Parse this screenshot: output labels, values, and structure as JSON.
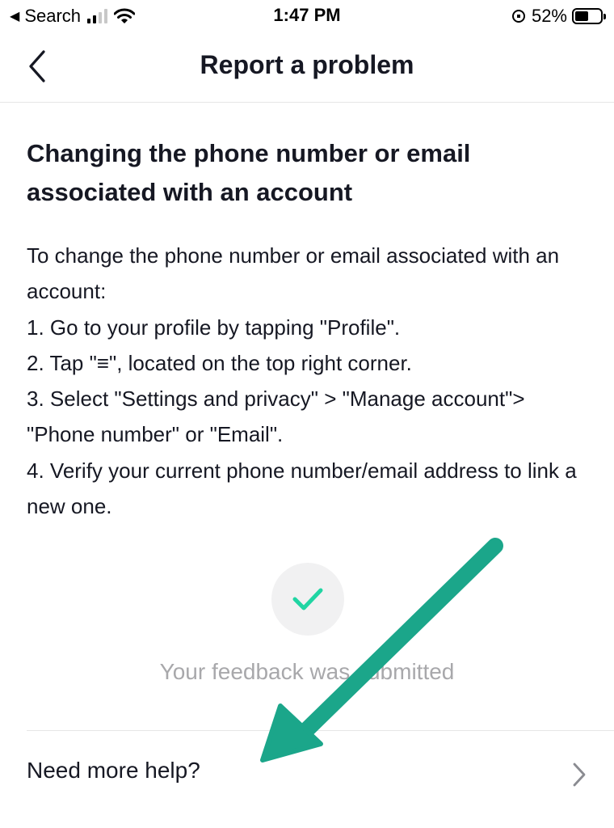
{
  "status_bar": {
    "back_app": "Search",
    "time": "1:47 PM",
    "battery_percent": "52%",
    "battery_level": 0.52
  },
  "nav": {
    "title": "Report a problem"
  },
  "article": {
    "title": "Changing the phone number or email associated with an account",
    "body_lines": [
      "To change the phone number or email associated with an account:",
      "1. Go to your profile by tapping \"Profile\".",
      "2. Tap \"≡\", located on the top right corner.",
      "3. Select \"Settings and privacy\" > \"Manage account\"> \"Phone number\" or \"Email\".",
      "4. Verify your current phone number/email address to link a new one."
    ]
  },
  "feedback": {
    "message": "Your feedback was submitted",
    "check_color": "#20d5a3"
  },
  "help": {
    "label": "Need more help?"
  },
  "annotation": {
    "arrow_color": "#1ba68a"
  }
}
